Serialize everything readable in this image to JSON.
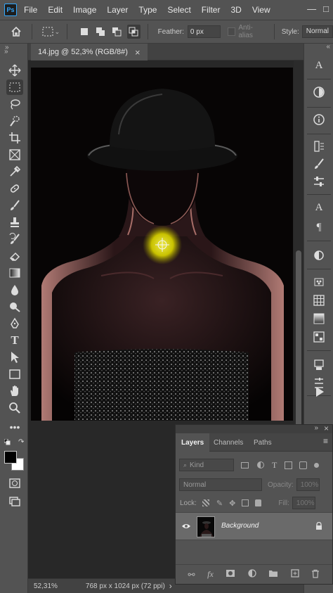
{
  "app": {
    "logo": "Ps"
  },
  "menu": [
    "File",
    "Edit",
    "Image",
    "Layer",
    "Type",
    "Select",
    "Filter",
    "3D",
    "View"
  ],
  "window_controls": {
    "minimize": "—",
    "maximize": "□"
  },
  "options": {
    "feather_label": "Feather:",
    "feather_value": "0 px",
    "antialias_label": "Anti-alias",
    "style_label": "Style:",
    "style_value": "Normal"
  },
  "document": {
    "tab_label": "14.jpg @ 52,3% (RGB/8#)",
    "close_glyph": "×"
  },
  "status": {
    "zoom": "52,31%",
    "doc_info": "768 px x 1024 px (72 ppi)",
    "arrow": "›"
  },
  "layers_panel": {
    "tabs": [
      "Layers",
      "Channels",
      "Paths"
    ],
    "kind_label": "Kind",
    "blend_mode": "Normal",
    "opacity_label": "Opacity:",
    "opacity_value": "100%",
    "lock_label": "Lock:",
    "fill_label": "Fill:",
    "fill_value": "100%",
    "layer_name": "Background"
  },
  "colors": {
    "ui_bg": "#535353",
    "dark_bg": "#282828",
    "accent_highlight": "#d8d400"
  }
}
